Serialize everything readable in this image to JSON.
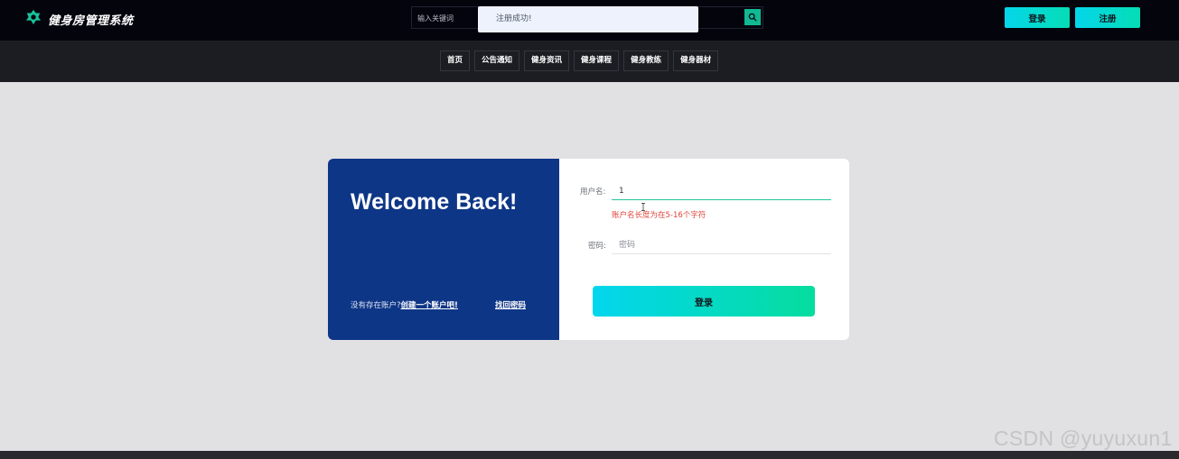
{
  "header": {
    "site_title": "健身房管理系统",
    "search_placeholder": "输入关键词",
    "login_label": "登录",
    "register_label": "注册",
    "logo_icon": "dumbbell-leaf-icon",
    "search_icon": "search-icon"
  },
  "toast": {
    "message": "注册成功!"
  },
  "nav": {
    "items": [
      {
        "label": "首页"
      },
      {
        "label": "公告通知"
      },
      {
        "label": "健身资讯"
      },
      {
        "label": "健身课程"
      },
      {
        "label": "健身教练"
      },
      {
        "label": "健身器材"
      }
    ]
  },
  "login_card": {
    "welcome": "Welcome Back!",
    "no_account_text": "没有存在账户?",
    "create_account_link": "创建一个账户吧!",
    "forgot_password_link": "找回密码",
    "username_label": "用户名:",
    "username_value": "1",
    "username_error": "账户名长度为在5-16个字符",
    "password_label": "密码:",
    "password_placeholder": "密码",
    "submit_label": "登录"
  },
  "watermark": "CSDN @yuyuxun1",
  "colors": {
    "topbar": "#04040d",
    "navbar": "#1c1d22",
    "card_left": "#0e3686",
    "accent_start": "#04d6ee",
    "accent_end": "#05dd9e",
    "error": "#e0453c",
    "page_background": "#e1e0e2"
  }
}
